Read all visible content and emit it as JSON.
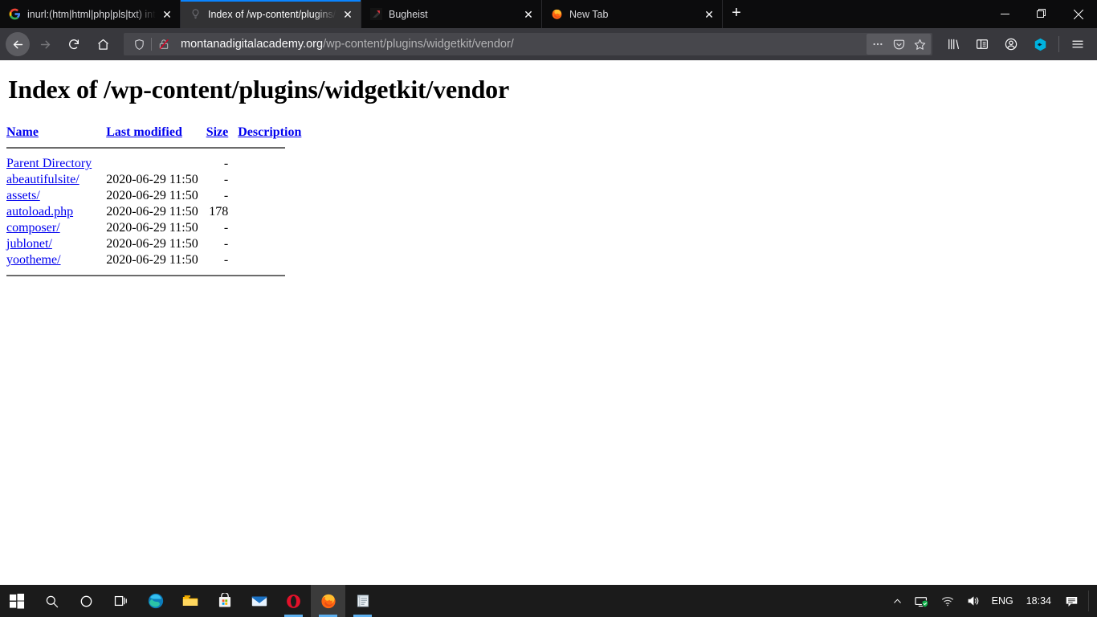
{
  "window": {
    "controls": {
      "minimize": "minimize-button",
      "restore": "restore-button",
      "close": "close-button"
    }
  },
  "tabs": [
    {
      "title": "inurl:(htm|html|php|pls|txt) inti",
      "favicon": "google-icon",
      "active": false,
      "close_label": "✕"
    },
    {
      "title": "Index of /wp-content/plugins/w",
      "favicon": "default-page-icon",
      "active": true,
      "close_label": "✕"
    },
    {
      "title": "Bugheist",
      "favicon": "bugheist-icon",
      "active": false,
      "close_label": "✕"
    },
    {
      "title": "New Tab",
      "favicon": "firefox-icon",
      "active": false,
      "close_label": "✕"
    }
  ],
  "new_tab_button": {
    "label": "+",
    "name": "new-tab-button"
  },
  "toolbar": {
    "back": "back-button",
    "forward": "forward-button",
    "reload": "reload-button",
    "home": "home-button",
    "url_host": "montanadigitalacademy.org",
    "url_path": "/wp-content/plugins/widgetkit/vendor/",
    "url_full": "montanadigitalacademy.org/wp-content/plugins/widgetkit/vendor/",
    "icons": {
      "tracking_protection": "shield-icon",
      "connection": "insecure-lock-icon",
      "page_actions": "•••",
      "pocket": "pocket-icon",
      "bookmark": "star-icon",
      "library": "library-icon",
      "sidebar": "sidebar-icon",
      "account": "account-icon",
      "extension": "extension-hexagon-icon",
      "menu": "hamburger-menu-icon"
    },
    "accent": "#0a84ff"
  },
  "page": {
    "title": "Index of /wp-content/plugins/widgetkit/vendor",
    "link_color": "#0000ee",
    "columns": [
      {
        "label": "Name",
        "key": "name"
      },
      {
        "label": "Last modified",
        "key": "modified"
      },
      {
        "label": "Size",
        "key": "size"
      },
      {
        "label": "Description",
        "key": "description"
      }
    ],
    "rows": [
      {
        "name": "Parent Directory",
        "modified": "",
        "size": "-",
        "description": ""
      },
      {
        "name": "abeautifulsite/",
        "modified": "2020-06-29 11:50",
        "size": "-",
        "description": ""
      },
      {
        "name": "assets/",
        "modified": "2020-06-29 11:50",
        "size": "-",
        "description": ""
      },
      {
        "name": "autoload.php",
        "modified": "2020-06-29 11:50",
        "size": "178",
        "description": ""
      },
      {
        "name": "composer/",
        "modified": "2020-06-29 11:50",
        "size": "-",
        "description": ""
      },
      {
        "name": "jublonet/",
        "modified": "2020-06-29 11:50",
        "size": "-",
        "description": ""
      },
      {
        "name": "yootheme/",
        "modified": "2020-06-29 11:50",
        "size": "-",
        "description": ""
      }
    ]
  },
  "taskbar": {
    "items": [
      {
        "name": "start-button",
        "icon": "windows-logo-icon",
        "state": ""
      },
      {
        "name": "taskbar-search",
        "icon": "search-icon",
        "state": ""
      },
      {
        "name": "taskbar-cortana",
        "icon": "cortana-circle-icon",
        "state": ""
      },
      {
        "name": "taskbar-task-view",
        "icon": "task-view-icon",
        "state": ""
      },
      {
        "name": "taskbar-edge",
        "icon": "edge-icon",
        "state": ""
      },
      {
        "name": "taskbar-file-explorer",
        "icon": "folder-icon",
        "state": ""
      },
      {
        "name": "taskbar-microsoft-store",
        "icon": "store-icon",
        "state": ""
      },
      {
        "name": "taskbar-mail",
        "icon": "mail-envelope-icon",
        "state": ""
      },
      {
        "name": "taskbar-opera",
        "icon": "opera-icon",
        "state": "running"
      },
      {
        "name": "taskbar-firefox",
        "icon": "firefox-icon",
        "state": "active"
      },
      {
        "name": "taskbar-notepad",
        "icon": "notepad-icon",
        "state": "running"
      }
    ],
    "tray": {
      "overflow": "chevron-up-icon",
      "security": "security-monitor-icon",
      "network": "wifi-icon",
      "volume": "speaker-icon",
      "language": "ENG",
      "clock": "18:34",
      "action_center": "notifications-icon"
    }
  }
}
